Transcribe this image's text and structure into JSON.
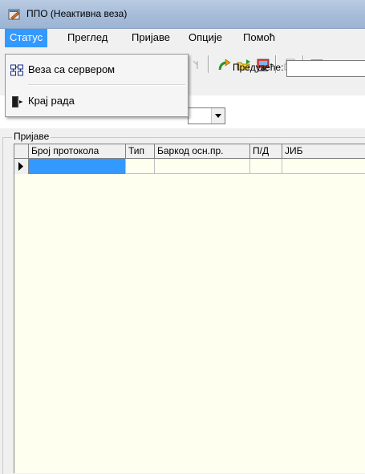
{
  "window": {
    "title": "ППО (Неактивна веза)"
  },
  "menu": [
    {
      "label": "Статус",
      "active": true
    },
    {
      "label": "Преглед"
    },
    {
      "label": "Пријаве"
    },
    {
      "label": "Опције"
    },
    {
      "label": "Помоћ"
    }
  ],
  "status_menu": {
    "items": [
      {
        "label": "Веза са сервером",
        "icon": "server-connection-icon"
      },
      {
        "label": "Крај рада",
        "icon": "exit-door-icon"
      }
    ]
  },
  "toolbar": {
    "company_label": "Предузеће:",
    "company_value": ""
  },
  "group": {
    "title": "Пријаве"
  },
  "grid": {
    "columns": [
      "Број протокола",
      "Тип",
      "Баркод осн.пр.",
      "П/Д",
      "ЈИБ"
    ],
    "rows": [
      [
        "",
        "",
        "",
        "",
        ""
      ]
    ]
  },
  "colors": {
    "selection": "#3399ff",
    "grid_bg": "#fffff0",
    "title_gradient": "#a6bcd9"
  }
}
